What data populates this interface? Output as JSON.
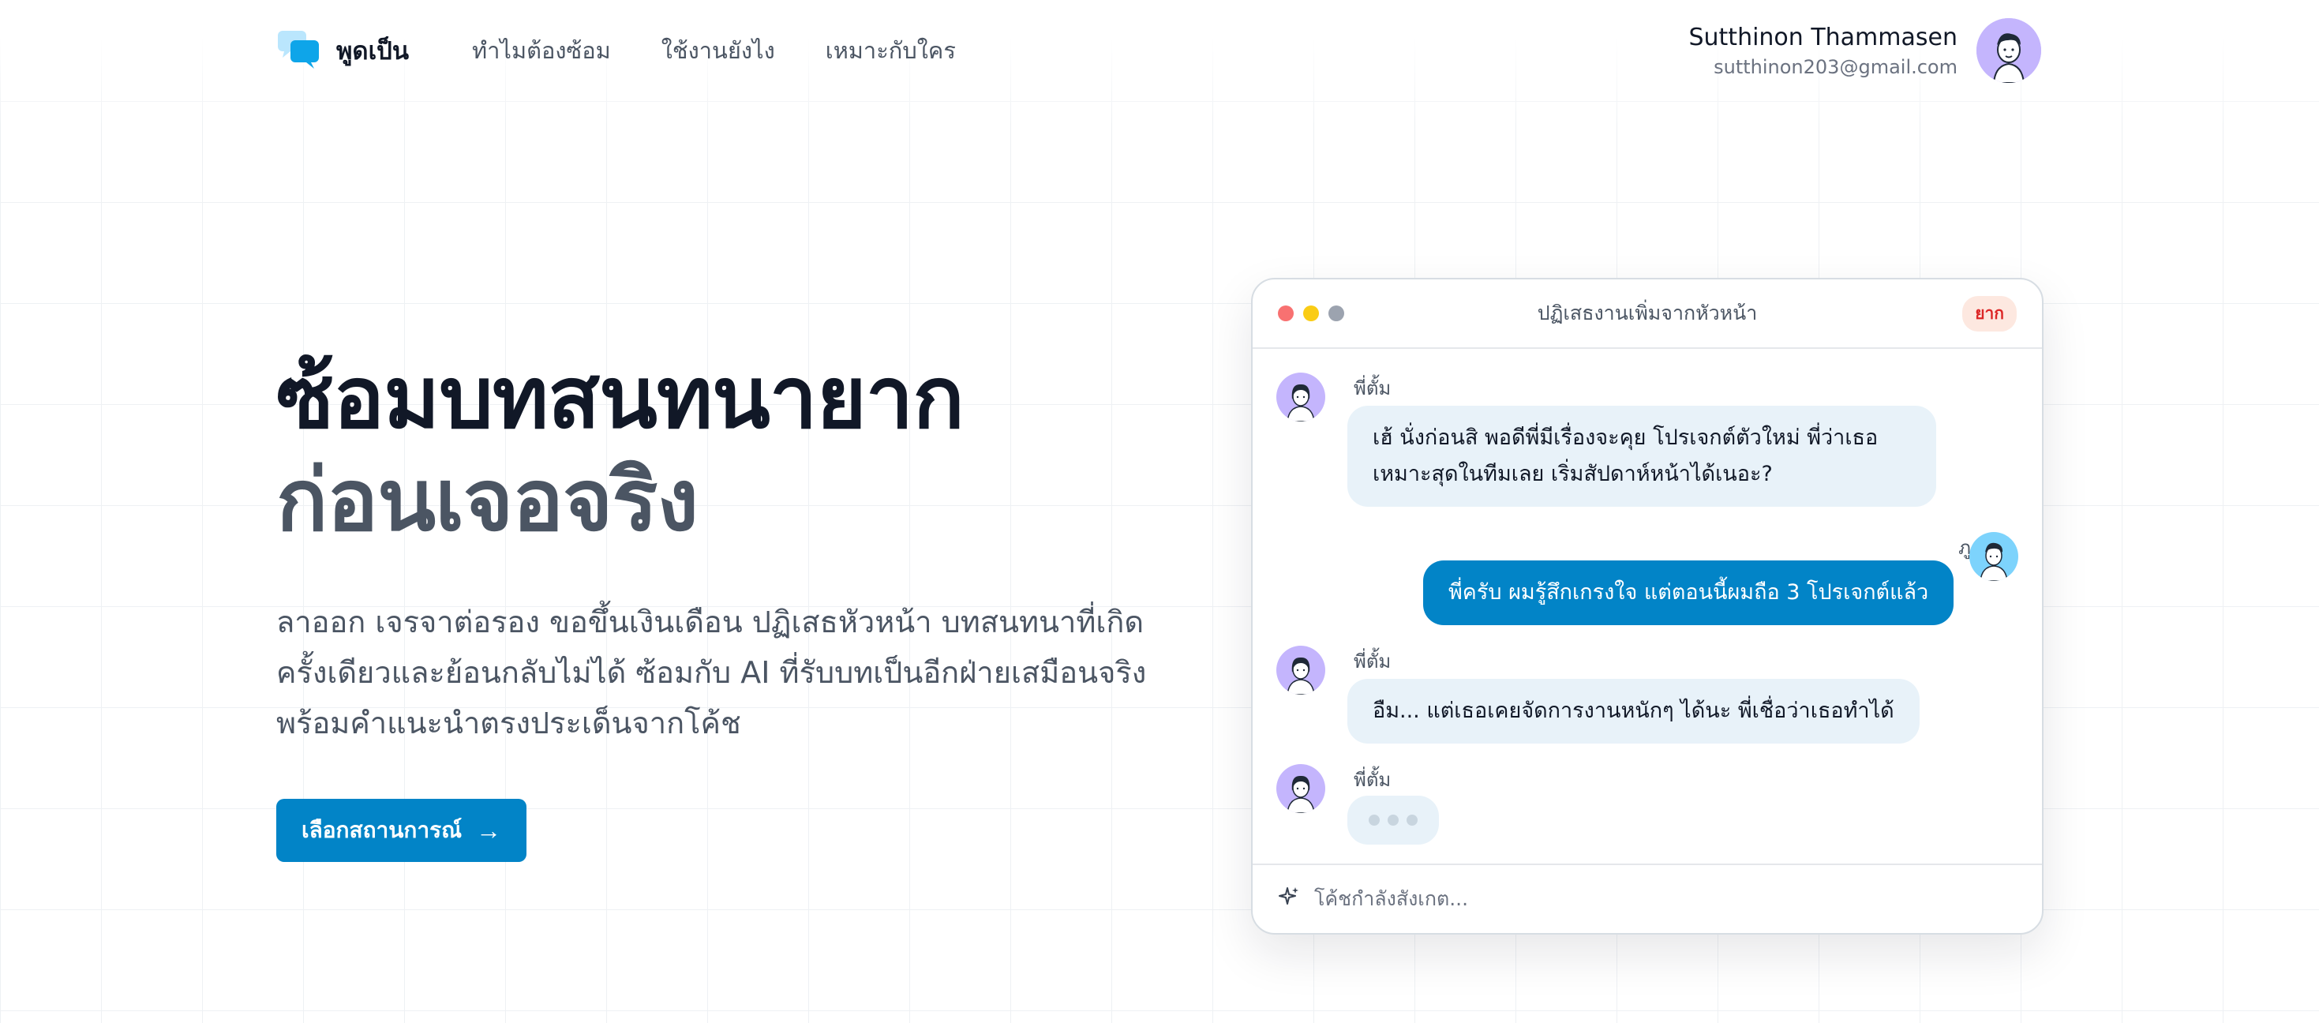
{
  "nav": {
    "brand": "พูดเป็น",
    "links": [
      "ทำไมต้องซ้อม",
      "ใช้งานยังไง",
      "เหมาะกับใคร"
    ],
    "user_name": "Sutthinon Thammasen",
    "user_email": "sutthinon203@gmail.com"
  },
  "hero": {
    "title_line1": "ซ้อมบทสนทนายาก",
    "title_line2": "ก่อนเจอจริง",
    "subtitle": "ลาออก เจรจาต่อรอง ขอขึ้นเงินเดือน ปฏิเสธหัวหน้า บทสนทนาที่เกิดครั้งเดียวและย้อนกลับไม่ได้ ซ้อมกับ AI ที่รับบทเป็นอีกฝ่ายเสมือนจริง พร้อมคำแนะนำตรงประเด็นจากโค้ช",
    "cta_label": "เลือกสถานการณ์",
    "cta_icon": "→"
  },
  "chat": {
    "title": "ปฏิเสธงานเพิ่มจากหัวหน้า",
    "difficulty": "ยาก",
    "messages": [
      {
        "sender": "พี่ตั้ม",
        "text_line1": "เฮ้ นั่งก่อนสิ พอดีพี่มีเรื่องจะคุย โปรเจกต์ตัวใหม่ พี่ว่าเธอ",
        "text_line2": "เหมาะสุดในทีมเลย เริ่มสัปดาห์หน้าได้เนอะ?"
      },
      {
        "sender": "ภู",
        "text": "พี่ครับ ผมรู้สึกเกรงใจ แต่ตอนนี้ผมถือ 3 โปรเจกต์แล้ว"
      },
      {
        "sender": "พี่ตั้ม",
        "text": "อืม... แต่เธอเคยจัดการงานหนักๆ ได้นะ พี่เชื่อว่าเธอทำได้"
      },
      {
        "sender": "พี่ตั้ม"
      }
    ],
    "footer_icon": "sparkle-icon",
    "footer_text": "โค้ชกำลังสังเกต..."
  },
  "colors": {
    "accent": "#0284c7",
    "dot_red": "#f87171",
    "dot_yellow": "#facc15",
    "dot_gray": "#9ca3af",
    "avatar_purple": "#c4b5fd",
    "avatar_blue": "#7dd3fc"
  }
}
